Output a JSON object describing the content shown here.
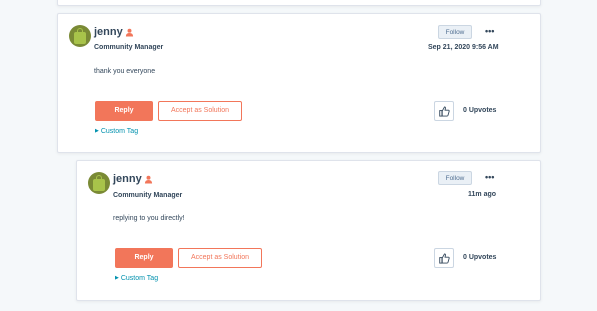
{
  "posts": [
    {
      "username": "jenny",
      "role": "Community Manager",
      "follow_label": "Follow",
      "more_label": "•••",
      "timestamp": "Sep 21, 2020 9:56 AM",
      "body": "thank you everyone",
      "reply_label": "Reply",
      "accept_label": "Accept as Solution",
      "custom_tag_label": "Custom Tag",
      "upvotes_label": "0 Upvotes"
    },
    {
      "username": "jenny",
      "role": "Community Manager",
      "follow_label": "Follow",
      "more_label": "•••",
      "timestamp": "11m ago",
      "body": "replying to you directly!",
      "reply_label": "Reply",
      "accept_label": "Accept as Solution",
      "custom_tag_label": "Custom Tag",
      "upvotes_label": "0 Upvotes"
    }
  ],
  "icons": {
    "avatar": "shopping-bag-avatar",
    "rank": "rank-badge-icon",
    "caret": "caret-right-icon",
    "upvote": "thumbs-up-icon"
  },
  "colors": {
    "accent": "#f2765a",
    "link": "#0091ae",
    "text": "#33475b",
    "background": "#f5f8fa"
  }
}
